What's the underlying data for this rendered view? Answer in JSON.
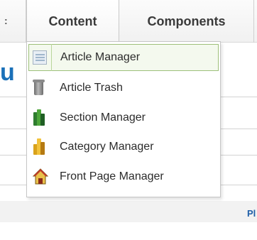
{
  "menubar": {
    "prev_fragment": ":",
    "content_label": "Content",
    "components_label": "Components"
  },
  "background": {
    "title_fragment": "u",
    "footer_fragment": "Pl"
  },
  "dropdown": {
    "items": [
      {
        "label": "Article Manager",
        "icon": "article-document-icon",
        "active": true
      },
      {
        "label": "Article Trash",
        "icon": "trash-can-icon",
        "active": false
      },
      {
        "label": "Section Manager",
        "icon": "green-books-icon",
        "active": false
      },
      {
        "label": "Category Manager",
        "icon": "yellow-books-icon",
        "active": false
      },
      {
        "label": "Front Page Manager",
        "icon": "home-icon",
        "active": false
      }
    ]
  },
  "colors": {
    "active_border": "#9ec07a",
    "link_blue": "#1a70b8"
  }
}
